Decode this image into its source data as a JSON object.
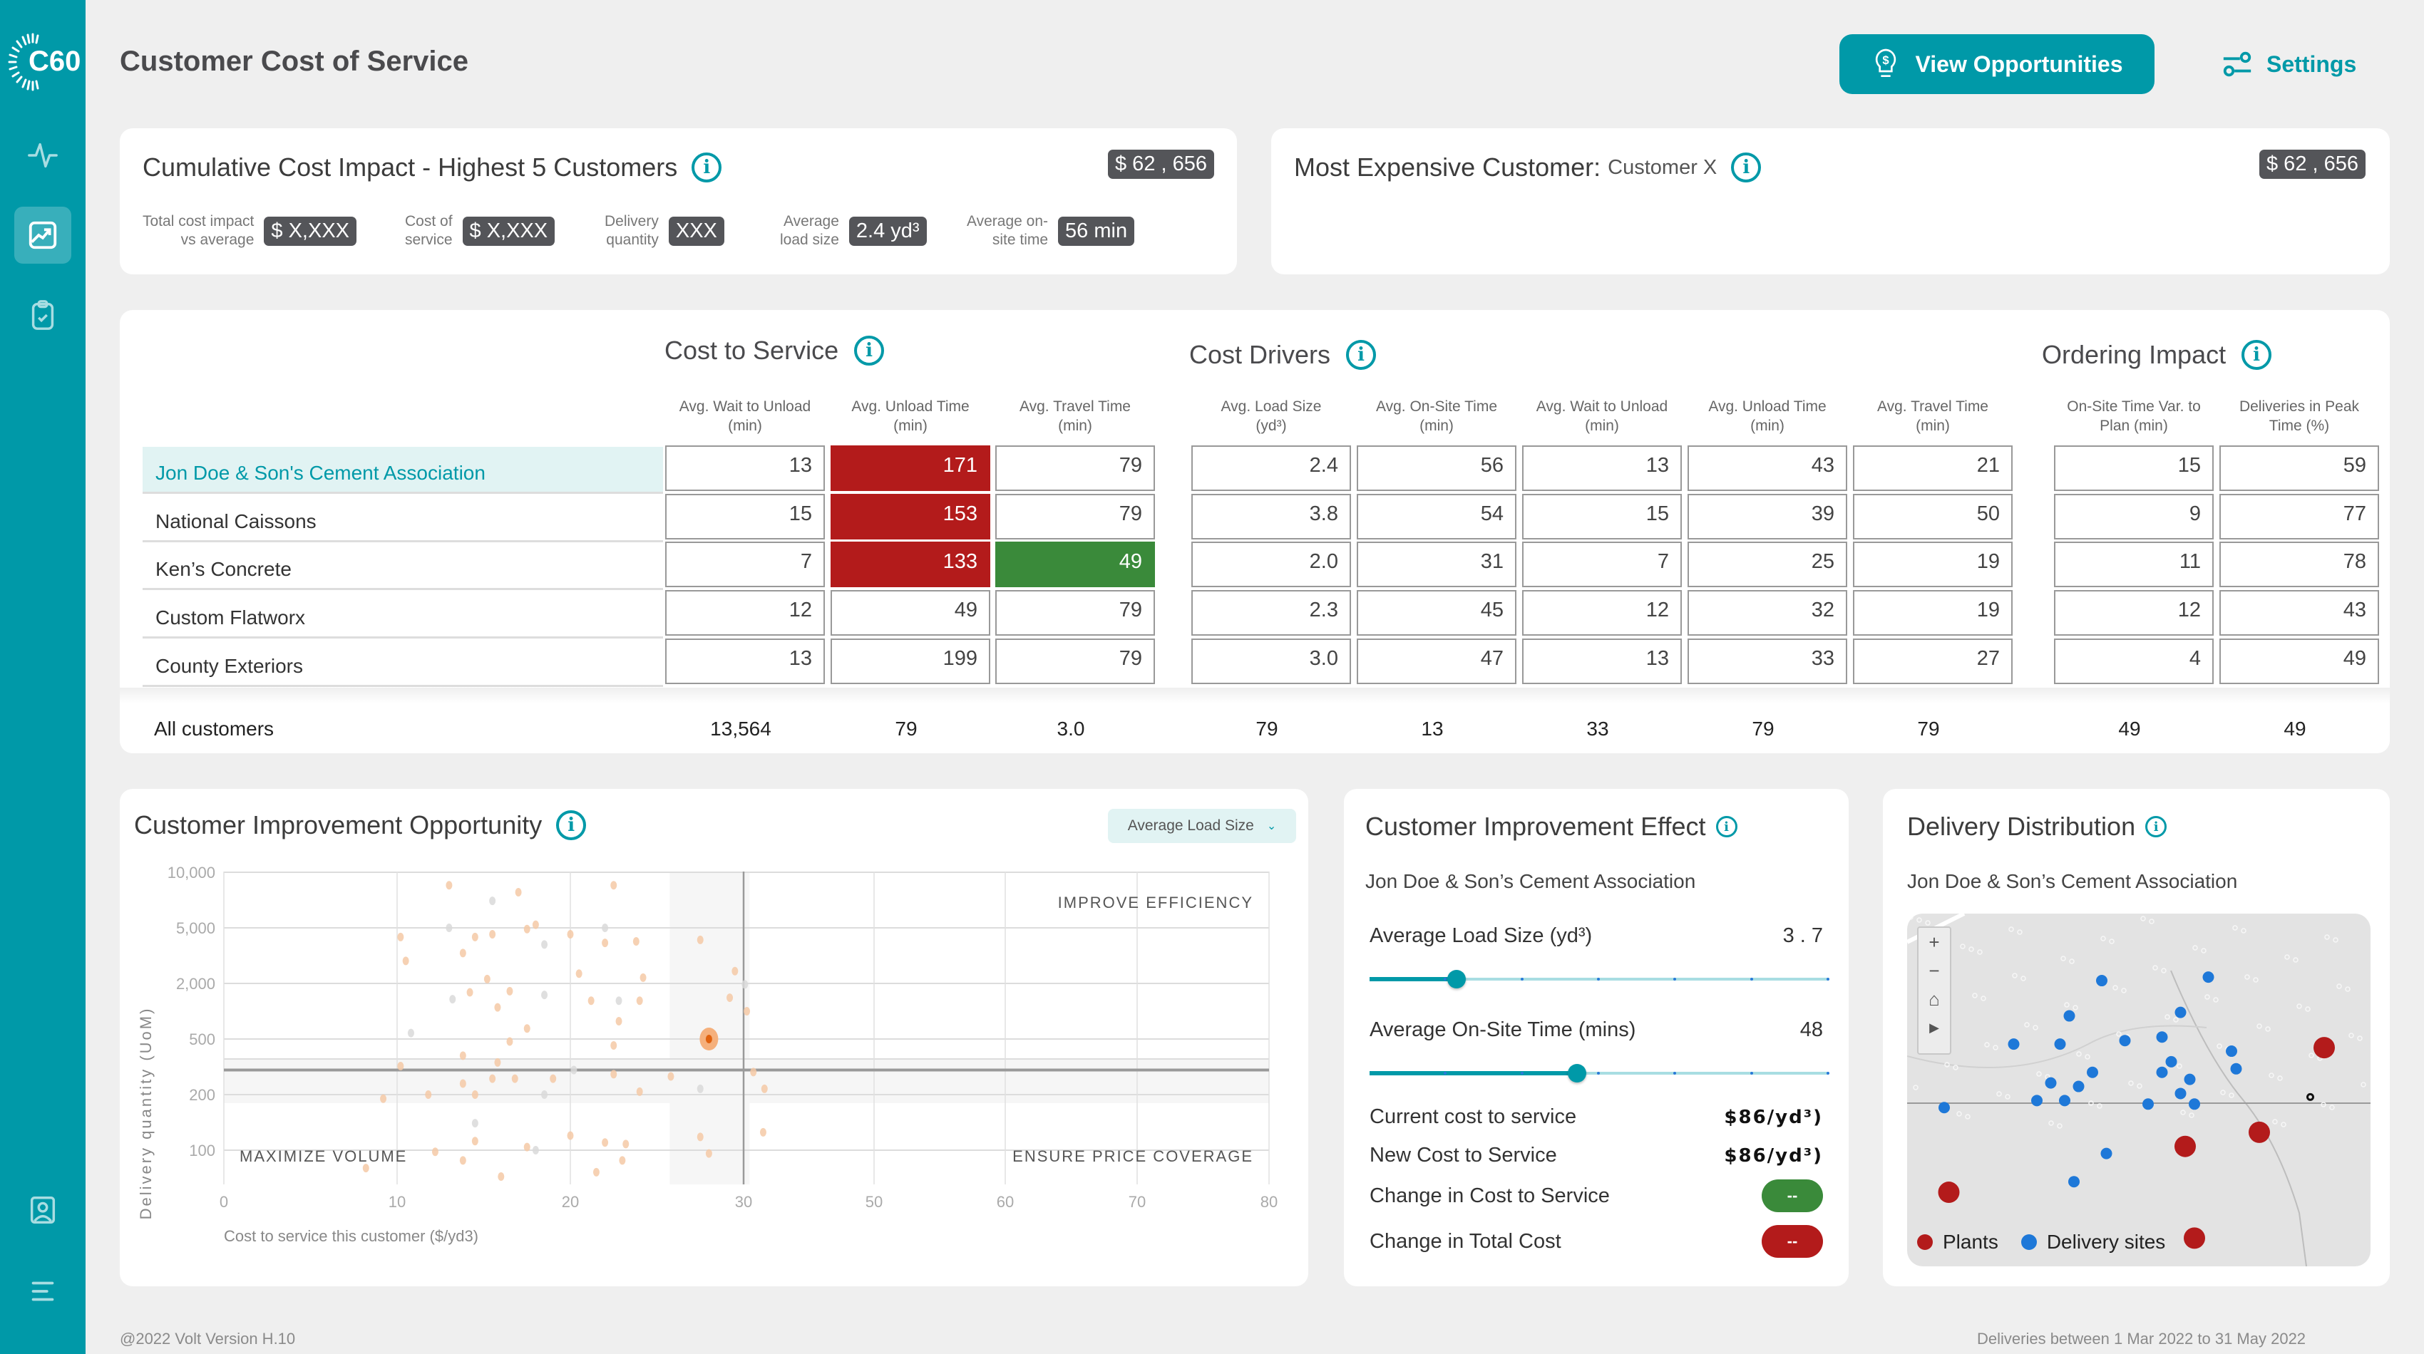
{
  "app": {
    "logo_text": "C60",
    "title": "Customer Cost of Service"
  },
  "sidebar": {
    "items": [
      {
        "name": "activity",
        "icon": "pulse-icon",
        "active": false
      },
      {
        "name": "analytics",
        "icon": "chart-trend-icon",
        "active": true
      },
      {
        "name": "tasks",
        "icon": "clipboard-check-icon",
        "active": false
      },
      {
        "name": "profile",
        "icon": "user-badge-icon",
        "active": false
      },
      {
        "name": "menu",
        "icon": "menu-icon",
        "active": false
      }
    ]
  },
  "header": {
    "view_opportunities_label": "View Opportunities",
    "view_opportunities_icon": "lightbulb-dollar-icon",
    "settings_label": "Settings",
    "settings_icon": "sliders-icon"
  },
  "cumulative": {
    "title": "Cumulative Cost Impact - Highest 5 Customers",
    "total_badge": "$ 62 , 656",
    "kpis": [
      {
        "label_1": "Total cost impact",
        "label_2": "vs average",
        "value": "$ X,XXX"
      },
      {
        "label_1": "Cost of",
        "label_2": "service",
        "value": "$ X,XXX"
      },
      {
        "label_1": "Delivery",
        "label_2": "quantity",
        "value": "XXX"
      },
      {
        "label_1": "Average",
        "label_2": "load size",
        "value": "2.4 yd³"
      },
      {
        "label_1": "Average on-",
        "label_2": "site time",
        "value": "56 min"
      }
    ]
  },
  "most_expensive": {
    "title": "Most Expensive Customer:",
    "customer": "Customer X",
    "badge": "$ 62 , 656"
  },
  "table": {
    "groups": [
      {
        "title": "Cost to Service",
        "columns": [
          [
            "Avg. Wait to Unload",
            "(min)"
          ],
          [
            "Avg. Unload Time",
            "(min)"
          ],
          [
            "Avg. Travel Time",
            "(min)"
          ]
        ]
      },
      {
        "title": "Cost Drivers",
        "columns": [
          [
            "Avg. Load Size",
            "(yd³)"
          ],
          [
            "Avg. On-Site Time",
            "(min)"
          ],
          [
            "Avg. Wait to Unload",
            "(min)"
          ],
          [
            "Avg. Unload Time",
            "(min)"
          ],
          [
            "Avg. Travel Time",
            "(min)"
          ]
        ]
      },
      {
        "title": "Ordering Impact",
        "columns": [
          [
            "On-Site Time Var. to",
            "Plan (min)"
          ],
          [
            "Deliveries in Peak",
            "Time (%)"
          ]
        ]
      }
    ],
    "rows": [
      {
        "name": "Jon Doe & Son's Cement Association",
        "selected": true,
        "values": [
          "13",
          "171",
          "79",
          "2.4",
          "56",
          "13",
          "43",
          "21",
          "15",
          "59"
        ],
        "status": [
          "",
          "red",
          "",
          "",
          "",
          "",
          "",
          "",
          "",
          ""
        ]
      },
      {
        "name": "National Caissons",
        "selected": false,
        "values": [
          "15",
          "153",
          "79",
          "3.8",
          "54",
          "15",
          "39",
          "50",
          "9",
          "77"
        ],
        "status": [
          "",
          "red",
          "",
          "",
          "",
          "",
          "",
          "",
          "",
          ""
        ]
      },
      {
        "name": "Ken’s Concrete",
        "selected": false,
        "values": [
          "7",
          "133",
          "49",
          "2.0",
          "31",
          "7",
          "25",
          "19",
          "11",
          "78"
        ],
        "status": [
          "",
          "red",
          "green",
          "",
          "",
          "",
          "",
          "",
          "",
          ""
        ]
      },
      {
        "name": "Custom Flatworx",
        "selected": false,
        "values": [
          "12",
          "49",
          "79",
          "2.3",
          "45",
          "12",
          "32",
          "19",
          "12",
          "43"
        ],
        "status": [
          "",
          "",
          "",
          "",
          "",
          "",
          "",
          "",
          "",
          ""
        ]
      },
      {
        "name": "County Exteriors",
        "selected": false,
        "values": [
          "13",
          "199",
          "79",
          "3.0",
          "47",
          "13",
          "33",
          "27",
          "4",
          "49"
        ],
        "status": [
          "",
          "",
          "",
          "",
          "",
          "",
          "",
          "",
          "",
          ""
        ]
      }
    ],
    "totals": {
      "name": "All customers",
      "values": [
        "13,564",
        "79",
        "3.0",
        "79",
        "13",
        "33",
        "79",
        "79",
        "49",
        "49"
      ]
    },
    "colors": {
      "red": "#b31b1b",
      "green": "#3a8a3a"
    }
  },
  "opportunity": {
    "title": "Customer Improvement Opportunity",
    "dropdown_value": "Average Load Size",
    "quadrants": {
      "top_right": "IMPROVE EFFICIENCY",
      "bottom_left": "MAXIMIZE VOLUME",
      "bottom_right": "ENSURE PRICE COVERAGE"
    }
  },
  "chart_data": {
    "type": "scatter",
    "title": "Customer Improvement Opportunity",
    "xlabel": "Cost to service this customer ($/yd3)",
    "ylabel": "Delivery quantity (UoM)",
    "x_ticks": [
      "0",
      "10",
      "20",
      "30",
      "50",
      "60",
      "70",
      "80"
    ],
    "y_ticks": [
      "100",
      "200",
      "500",
      "2,000",
      "5,000",
      "10,000"
    ],
    "y_scale": "log-ish categorical",
    "grid": true,
    "reference_lines": {
      "x": 30,
      "y": 300
    },
    "highlight": {
      "x": 28,
      "y": 500,
      "label": "Jon Doe & Son's Cement Association"
    },
    "points": [
      [
        13,
        8500,
        "o"
      ],
      [
        17,
        7800,
        "o"
      ],
      [
        22.5,
        8500,
        "o"
      ],
      [
        15.5,
        7000,
        "g"
      ],
      [
        13,
        5000,
        "g"
      ],
      [
        18,
        5200,
        "o"
      ],
      [
        17.5,
        4900,
        "o"
      ],
      [
        22,
        5000,
        "g"
      ],
      [
        10.2,
        4300,
        "o"
      ],
      [
        14.5,
        4300,
        "o"
      ],
      [
        15.5,
        4500,
        "o"
      ],
      [
        20,
        4500,
        "o"
      ],
      [
        22,
        3900,
        "o"
      ],
      [
        23.8,
        4000,
        "o"
      ],
      [
        27.5,
        4100,
        "o"
      ],
      [
        18.5,
        3800,
        "g"
      ],
      [
        13.8,
        3300,
        "o"
      ],
      [
        10.5,
        2900,
        "o"
      ],
      [
        20.5,
        2350,
        "o"
      ],
      [
        24.2,
        2200,
        "o"
      ],
      [
        15.2,
        2150,
        "o"
      ],
      [
        29.5,
        2450,
        "o"
      ],
      [
        30.2,
        1950,
        "g"
      ],
      [
        14.2,
        1600,
        "o"
      ],
      [
        16.5,
        1650,
        "o"
      ],
      [
        18.5,
        1500,
        "g"
      ],
      [
        13.2,
        1350,
        "g"
      ],
      [
        21.2,
        1300,
        "o"
      ],
      [
        22.8,
        1300,
        "g"
      ],
      [
        24,
        1300,
        "o"
      ],
      [
        29.2,
        1400,
        "o"
      ],
      [
        15.8,
        1100,
        "o"
      ],
      [
        30.5,
        1000,
        "o"
      ],
      [
        22.8,
        780,
        "o"
      ],
      [
        17.5,
        650,
        "o"
      ],
      [
        10.8,
        580,
        "g"
      ],
      [
        16.5,
        480,
        "o"
      ],
      [
        22.5,
        450,
        "o"
      ],
      [
        13.8,
        380,
        "o"
      ],
      [
        15.8,
        340,
        "o"
      ],
      [
        10.2,
        320,
        "o"
      ],
      [
        20.2,
        300,
        "g"
      ],
      [
        22.5,
        280,
        "o"
      ],
      [
        31.5,
        290,
        "o"
      ],
      [
        25.8,
        270,
        "o"
      ],
      [
        15.5,
        260,
        "o"
      ],
      [
        16.8,
        260,
        "o"
      ],
      [
        19,
        260,
        "o"
      ],
      [
        13.8,
        240,
        "o"
      ],
      [
        27.5,
        220,
        "g"
      ],
      [
        24,
        210,
        "o"
      ],
      [
        33.2,
        220,
        "o"
      ],
      [
        11.8,
        200,
        "o"
      ],
      [
        14.5,
        200,
        "o"
      ],
      [
        18.5,
        200,
        "g"
      ],
      [
        9.2,
        190,
        "o"
      ],
      [
        14.5,
        140,
        "g"
      ],
      [
        20,
        120,
        "o"
      ],
      [
        27.5,
        118,
        "o"
      ],
      [
        33,
        125,
        "o"
      ],
      [
        14.5,
        112,
        "o"
      ],
      [
        22,
        110,
        "o"
      ],
      [
        23.2,
        108,
        "o"
      ],
      [
        17.5,
        104,
        "o"
      ],
      [
        18,
        100,
        "g"
      ],
      [
        12.2,
        98,
        "o"
      ],
      [
        28,
        96,
        "o"
      ],
      [
        13.8,
        88,
        "o"
      ],
      [
        23,
        88,
        "o"
      ],
      [
        8.2,
        80,
        "o"
      ],
      [
        21.5,
        76,
        "o"
      ],
      [
        16,
        72,
        "o"
      ]
    ]
  },
  "effect": {
    "title": "Customer Improvement Effect",
    "customer": "Jon Doe & Son’s Cement Association",
    "sliders": [
      {
        "label": "Average Load Size (yd³)",
        "value_text": "3 . 7",
        "fraction": 0.19,
        "ticks": 6
      },
      {
        "label": "Average On-Site Time (mins)",
        "value_text": "48",
        "fraction": 0.452,
        "ticks": 6
      }
    ],
    "rows": [
      {
        "label": "Current cost to service",
        "value": "$86/yd³)"
      },
      {
        "label": "New Cost to Service",
        "value": "$86/yd³)"
      }
    ],
    "changes": [
      {
        "label": "Change in Cost to Service",
        "value": "--",
        "color": "#3a8a3a"
      },
      {
        "label": "Change in Total Cost",
        "value": "--",
        "color": "#b31b1b"
      }
    ]
  },
  "distribution": {
    "title": "Delivery Distribution",
    "customer": "Jon Doe & Son’s Cement Association",
    "legend": [
      {
        "label": "Plants",
        "color": "#b31b1b"
      },
      {
        "label": "Delivery sites",
        "color": "#1e78d8"
      }
    ],
    "plants": [
      [
        0.9,
        0.38
      ],
      [
        0.76,
        0.62
      ],
      [
        0.6,
        0.66
      ],
      [
        0.09,
        0.79
      ],
      [
        0.62,
        0.92
      ]
    ],
    "sites": [
      [
        0.42,
        0.19
      ],
      [
        0.65,
        0.18
      ],
      [
        0.35,
        0.29
      ],
      [
        0.59,
        0.28
      ],
      [
        0.23,
        0.37
      ],
      [
        0.33,
        0.37
      ],
      [
        0.47,
        0.36
      ],
      [
        0.55,
        0.35
      ],
      [
        0.7,
        0.39
      ],
      [
        0.57,
        0.42
      ],
      [
        0.4,
        0.45
      ],
      [
        0.55,
        0.45
      ],
      [
        0.61,
        0.47
      ],
      [
        0.37,
        0.49
      ],
      [
        0.31,
        0.48
      ],
      [
        0.71,
        0.44
      ],
      [
        0.34,
        0.53
      ],
      [
        0.28,
        0.53
      ],
      [
        0.59,
        0.51
      ],
      [
        0.52,
        0.54
      ],
      [
        0.62,
        0.54
      ],
      [
        0.08,
        0.55
      ],
      [
        0.43,
        0.68
      ],
      [
        0.36,
        0.76
      ]
    ]
  },
  "footer": {
    "left": "@2022 Volt  Version H.10",
    "right": "Deliveries between 1 Mar 2022 to 31 May 2022"
  }
}
